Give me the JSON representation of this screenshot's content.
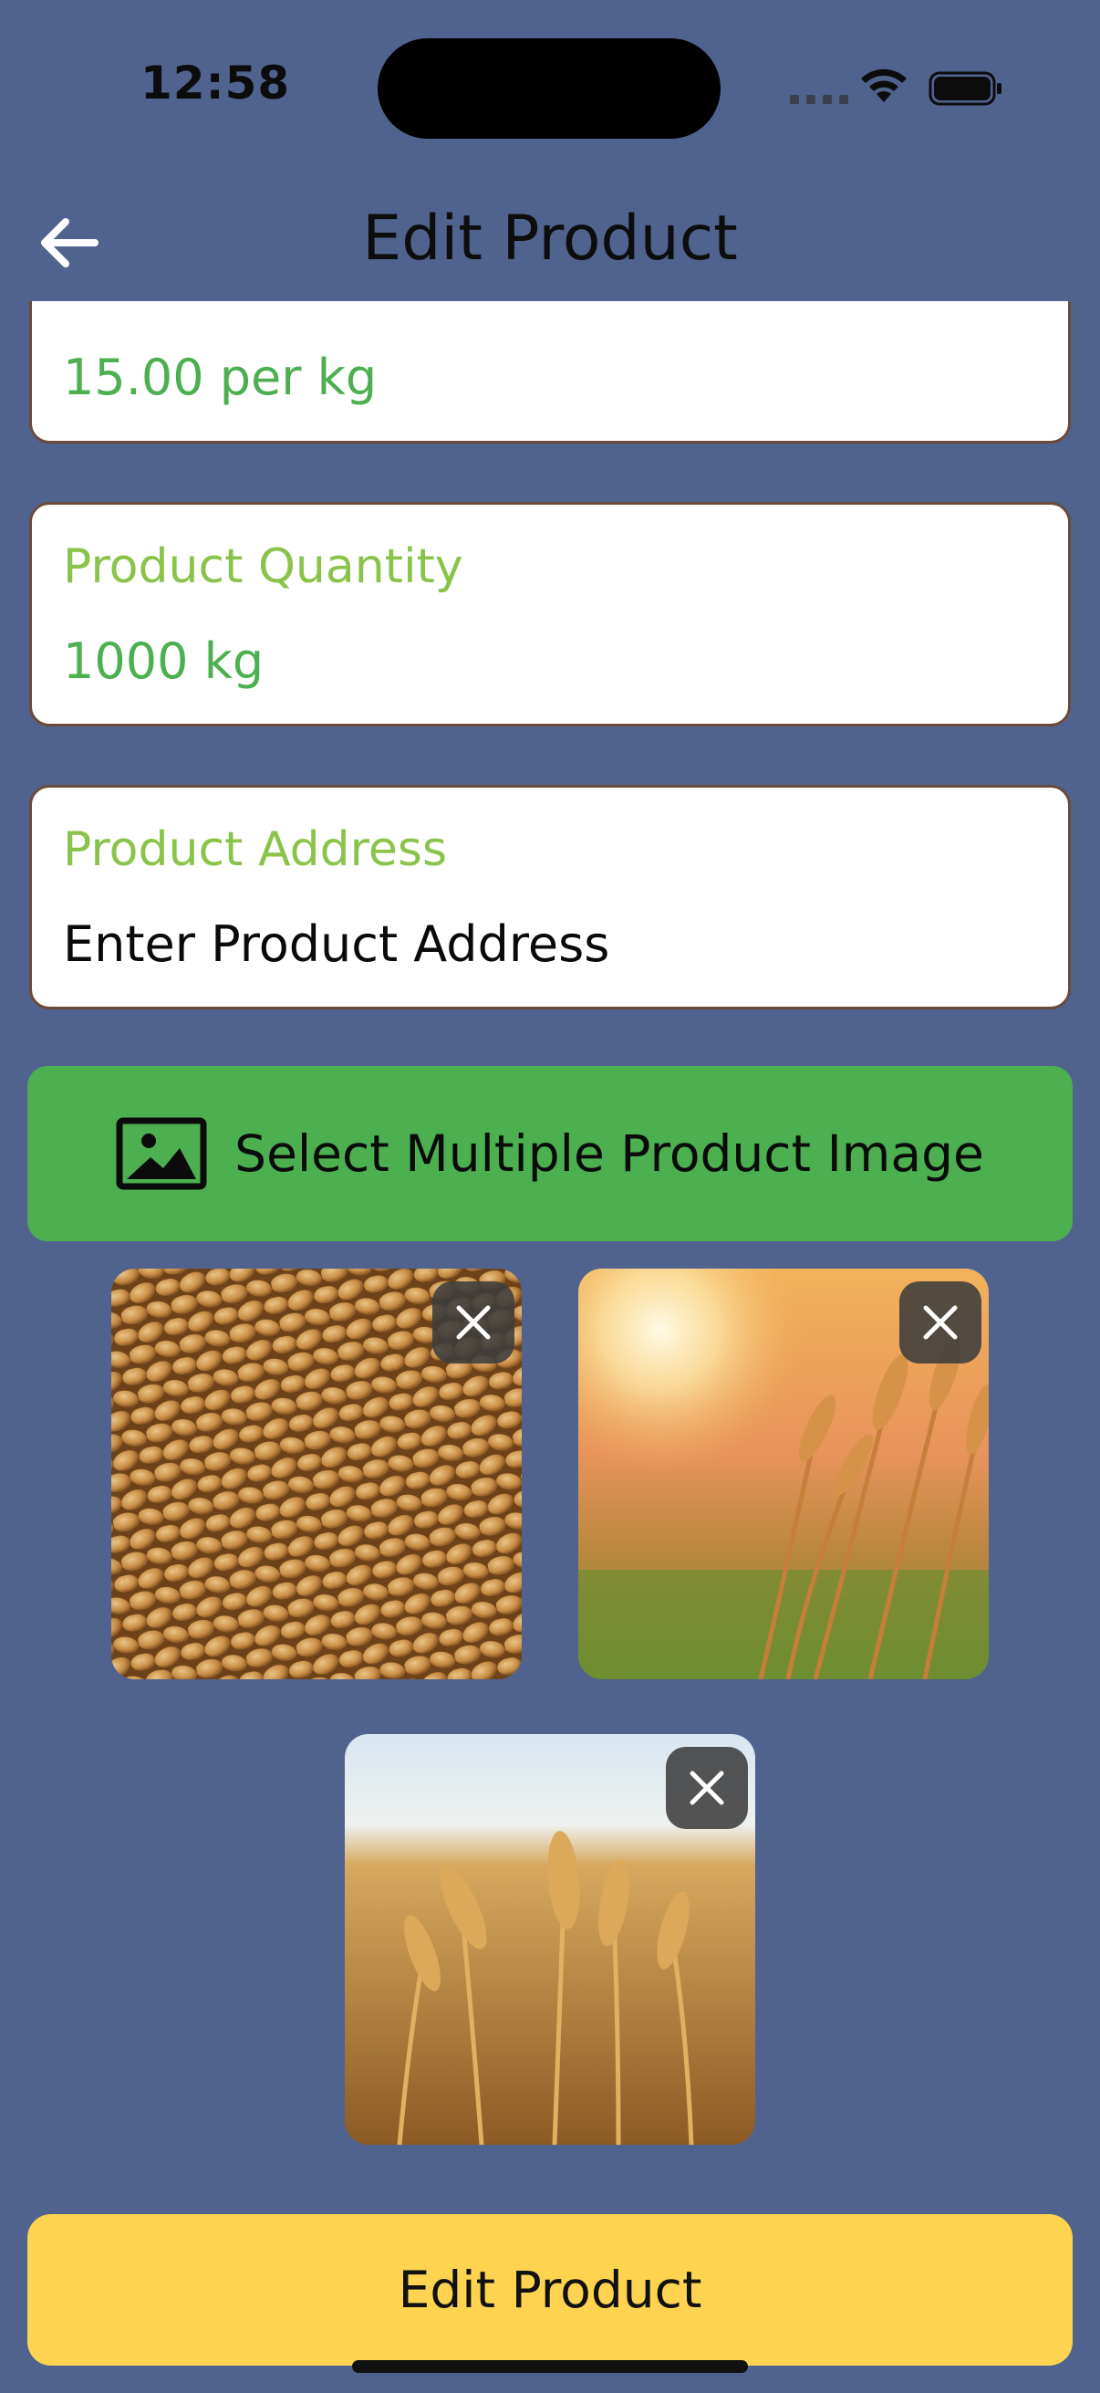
{
  "status_bar": {
    "time": "12:58"
  },
  "header": {
    "title": "Edit Product",
    "back_icon": "arrow-left-icon"
  },
  "fields": {
    "price": {
      "value": "15.00 per kg"
    },
    "quantity": {
      "label": "Product Quantity",
      "value": "1000 kg"
    },
    "address": {
      "label": "Product Address",
      "placeholder": "Enter Product Address"
    }
  },
  "image_picker": {
    "button_label": "Select Multiple Product Image",
    "icon": "image-icon"
  },
  "images": [
    {
      "subject": "wheat grains close-up",
      "remove_icon": "close-icon"
    },
    {
      "subject": "wheat field at sunset",
      "remove_icon": "close-icon"
    },
    {
      "subject": "golden wheat ears",
      "remove_icon": "close-icon"
    }
  ],
  "submit": {
    "label": "Edit Product"
  },
  "colors": {
    "background": "#50638f",
    "label_green": "#8bc34a",
    "value_green": "#4caf50",
    "button_green": "#4caf50",
    "button_yellow": "#fdd34f",
    "card_border": "#6a4a3a"
  }
}
